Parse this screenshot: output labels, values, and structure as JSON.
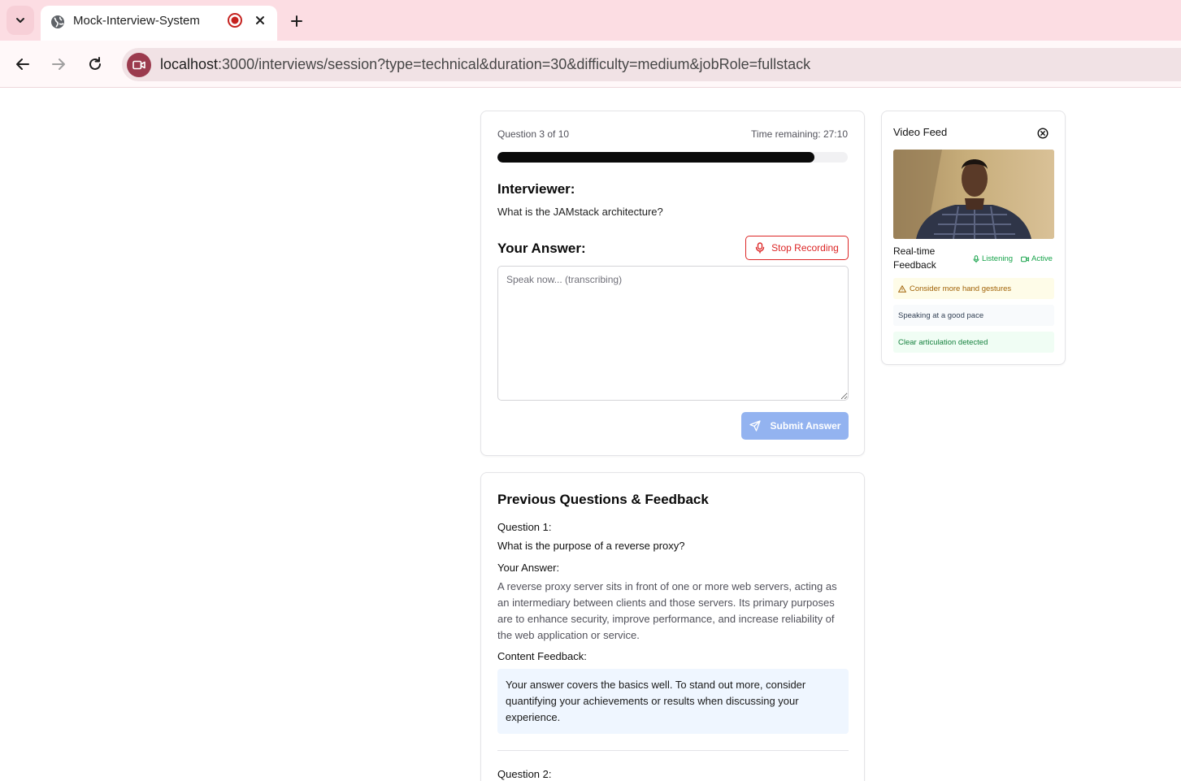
{
  "browser": {
    "tab_title": "Mock-Interview-System",
    "url_host": "localhost",
    "url_path": ":3000/interviews/session?type=technical&duration=30&difficulty=medium&jobRole=fullstack"
  },
  "interview": {
    "question_counter": "Question 3 of 10",
    "time_remaining": "Time remaining: 27:10",
    "progress_fraction": 0.905,
    "interviewer_heading": "Interviewer:",
    "question_text": "What is the JAMstack architecture?",
    "answer_heading": "Your Answer:",
    "stop_recording_label": "Stop Recording",
    "answer_placeholder": "Speak now... (transcribing)",
    "submit_label": "Submit Answer"
  },
  "previous": {
    "title": "Previous Questions & Feedback",
    "items": [
      {
        "question_label": "Question 1:",
        "question": "What is the purpose of a reverse proxy?",
        "answer_label": "Your Answer:",
        "answer": "A reverse proxy server sits in front of one or more web servers, acting as an intermediary between clients and those servers. Its primary purposes are to enhance security, improve performance, and increase reliability of the web application or service.",
        "feedback_label": "Content Feedback:",
        "feedback": "Your answer covers the basics well. To stand out more, consider quantifying your achievements or results when discussing your experience."
      },
      {
        "question_label": "Question 2:"
      }
    ]
  },
  "video": {
    "title": "Video Feed",
    "realtime_label": "Real-time Feedback",
    "status_listening": "Listening",
    "status_active": "Active",
    "feedback": [
      {
        "type": "warning",
        "text": "Consider more hand gestures"
      },
      {
        "type": "neutral",
        "text": "Speaking at a good pace"
      },
      {
        "type": "positive",
        "text": "Clear articulation detected"
      }
    ]
  },
  "colors": {
    "tabbar_bg": "#fcdde3",
    "accent_red": "#dc2626",
    "submit_disabled": "#93b3f0",
    "feedback_bg": "#eff6ff",
    "status_green": "#16a34a"
  }
}
